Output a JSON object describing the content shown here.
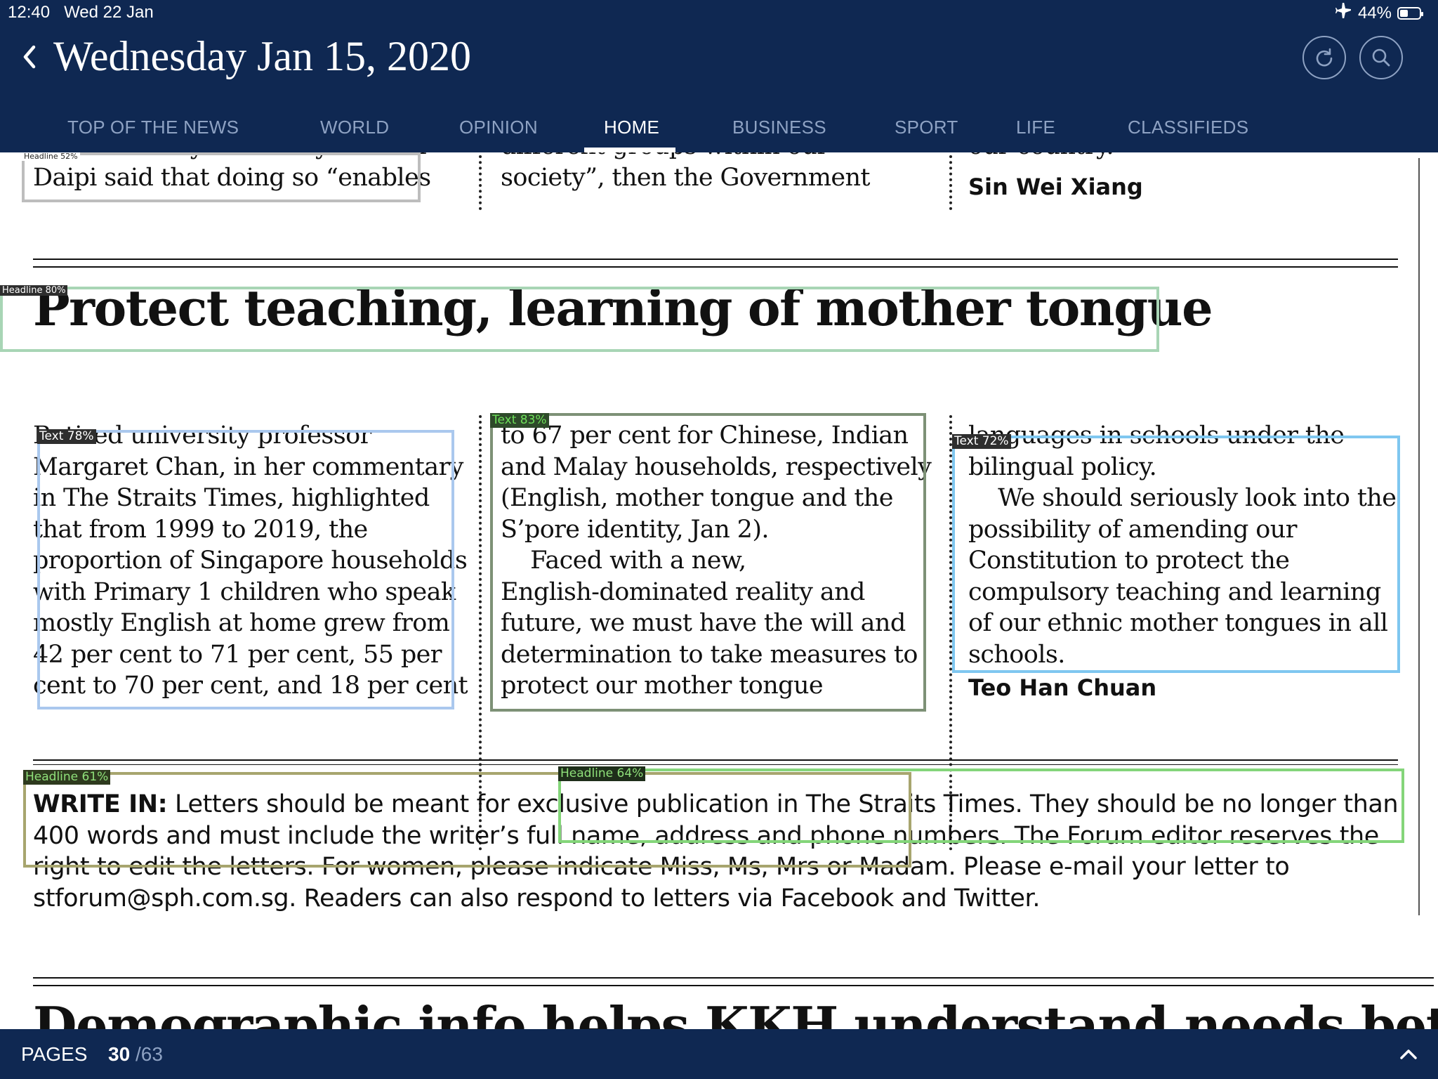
{
  "status_bar": {
    "time": "12:40",
    "date": "Wed 22 Jan",
    "battery": "44%"
  },
  "header": {
    "title": "Wednesday Jan 15, 2020",
    "back_icon": "chevron-left-icon",
    "refresh_icon": "refresh-icon",
    "search_icon": "search-icon"
  },
  "nav": {
    "tabs": [
      {
        "label": "TOP OF THE NEWS"
      },
      {
        "label": "WORLD"
      },
      {
        "label": "OPINION"
      },
      {
        "label": "HOME",
        "active": true
      },
      {
        "label": "BUSINESS"
      },
      {
        "label": "SPORT"
      },
      {
        "label": "LIFE"
      },
      {
        "label": "CLASSIFIEDS"
      }
    ]
  },
  "prev_article": {
    "col1": "Parliamentary Secretary Hawazi\nDaipi said that doing so “enables",
    "col2": "different groups within our\nsociety”, then the Government",
    "col3": "our country.",
    "byline": "Sin Wei Xiang"
  },
  "article": {
    "headline": "Protect teaching, learning of mother tongue",
    "col1": "Retired university professor\nMargaret Chan, in her commentary\nin The Straits Times, highlighted\nthat from 1999 to 2019, the\nproportion of Singapore households\nwith Primary 1 children who speak\nmostly English at home grew from\n42 per cent to 71 per cent, 55 per\ncent to 70 per cent, and 18 per cent",
    "col2": "to 67 per cent for Chinese, Indian\nand Malay households, respectively\n(English, mother tongue and the\nS’pore identity, Jan 2).\n    Faced with a new,\nEnglish-dominated reality and\nfuture, we must have the will and\ndetermination to take measures to\nprotect our mother tongue",
    "col3": "languages in schools under the\nbilingual policy.\n    We should seriously look into the\npossibility of amending our\nConstitution to protect the\ncompulsory teaching and learning\nof our ethnic mother tongues in all\nschools.",
    "byline": "Teo Han Chuan"
  },
  "write_in": {
    "label": "WRITE IN:",
    "text": " Letters should be meant for exclusive publication in The Straits Times. They should be no longer than 400 words and must include the writer’s full name, address and phone numbers. The Forum editor reserves the right to edit the letters. For women, please indicate Miss, Ms, Mrs or Madam. Please e-mail your letter to stforum@sph.com.sg. Readers can also respond to letters via Facebook and Twitter."
  },
  "next_article": {
    "headline": "Demographic info helps KKH understand needs better"
  },
  "detections": [
    {
      "label": "Headline 52%",
      "color": "#bdbdbd"
    },
    {
      "label": "Headline 80%",
      "color": "#a8d5b5"
    },
    {
      "label": "Text 78%",
      "color": "#aac8ee"
    },
    {
      "label": "Text 83%",
      "color": "#7d9176"
    },
    {
      "label": "Text 72%",
      "color": "#7fc7f0"
    },
    {
      "label": "Headline 61%",
      "color": "#a7a56e"
    },
    {
      "label": "Headline 64%",
      "color": "#84d57a"
    }
  ],
  "footer": {
    "pages_label": "PAGES",
    "current_page": "30",
    "total_pages": "/63",
    "expand_icon": "chevron-up-icon"
  }
}
